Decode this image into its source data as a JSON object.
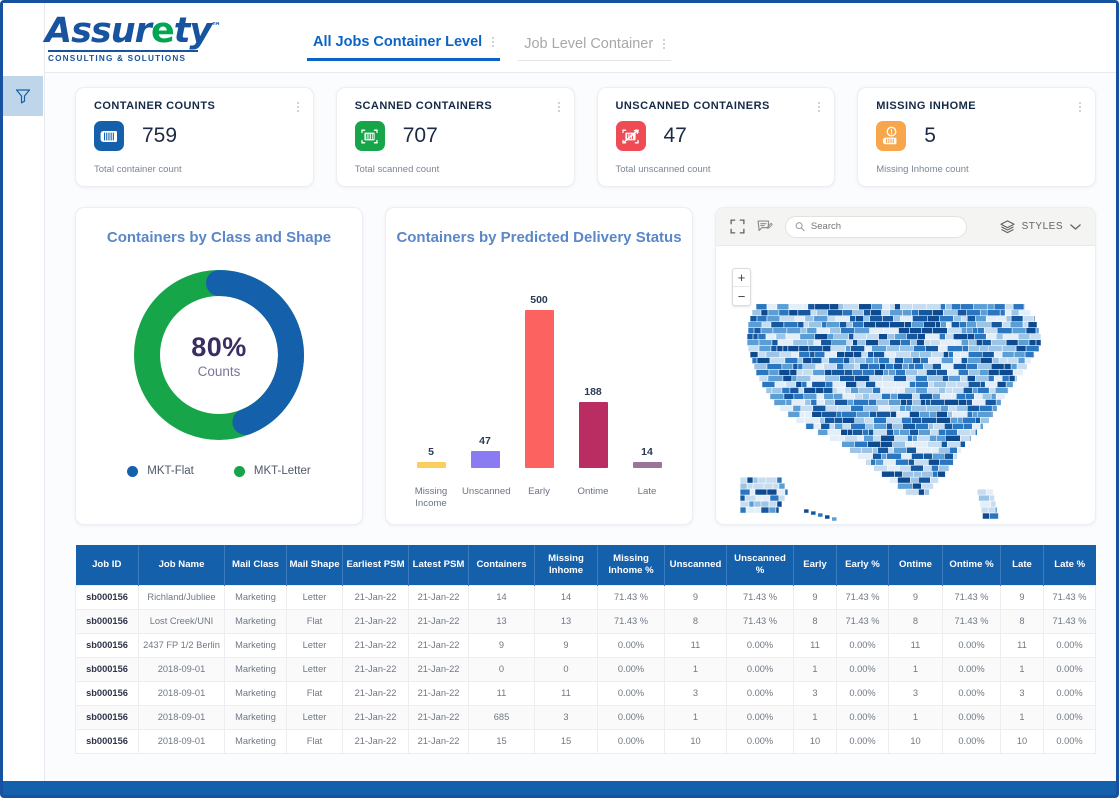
{
  "brand": {
    "wordmark_a": "Assur",
    "wordmark_e": "e",
    "wordmark_b": "ty",
    "tm": "™",
    "tagline": "CONSULTING & SOLUTIONS",
    "primary_blue": "#18539f",
    "accent_green": "#00a651"
  },
  "tabs": [
    {
      "label": "All Jobs Container Level",
      "active": true
    },
    {
      "label": "Job Level Container",
      "active": false
    }
  ],
  "kpis": [
    {
      "title": "CONTAINER COUNTS",
      "value": "759",
      "subtitle": "Total container count",
      "icon": "container-icon",
      "color": "#1560ab"
    },
    {
      "title": "SCANNED CONTAINERS",
      "value": "707",
      "subtitle": "Total scanned count",
      "icon": "scanned-container-icon",
      "color": "#17a54a"
    },
    {
      "title": "UNSCANNED CONTAINERS",
      "value": "47",
      "subtitle": "Total unscanned count",
      "icon": "unscanned-container-icon",
      "color": "#ef4b54"
    },
    {
      "title": "MISSING INHOME",
      "value": "5",
      "subtitle": "Missing Inhome count",
      "icon": "missing-inhome-icon",
      "color": "#f7a64b"
    }
  ],
  "chart_data": [
    {
      "type": "pie",
      "title": "Containers by Class and Shape",
      "center_value": "80%",
      "center_label": "Counts",
      "legend_position": "bottom",
      "categories": [
        "MKT-Flat",
        "MKT-Letter"
      ],
      "values": [
        44,
        56
      ],
      "colors": [
        "#1560ab",
        "#17a54a"
      ]
    },
    {
      "type": "bar",
      "title": "Containers by Predicted Delivery Status",
      "categories": [
        "Missing Income",
        "Unscanned",
        "Early",
        "Ontime",
        "Late"
      ],
      "values": [
        5,
        47,
        500,
        188,
        14
      ],
      "colors": [
        "#fbcf5f",
        "#8b7bf2",
        "#fb6260",
        "#b92d62",
        "#997598"
      ],
      "xlabel": "",
      "ylabel": "",
      "ylim": [
        0,
        500
      ],
      "grid": false
    }
  ],
  "map": {
    "search_placeholder": "Search",
    "styles_label": "STYLES",
    "zoom_in": "+",
    "zoom_out": "−"
  },
  "table": {
    "columns": [
      "Job ID",
      "Job Name",
      "Mail Class",
      "Mail Shape",
      "Earliest PSM",
      "Latest PSM",
      "Containers",
      "Missing Inhome",
      "Missing Inhome %",
      "Unscanned",
      "Unscanned %",
      "Early",
      "Early %",
      "Ontime",
      "Ontime %",
      "Late",
      "Late %"
    ],
    "rows": [
      [
        "sb000156",
        "Richland/Jubliee",
        "Marketing",
        "Letter",
        "21-Jan-22",
        "21-Jan-22",
        "14",
        "14",
        "71.43 %",
        "9",
        "71.43 %",
        "9",
        "71.43 %",
        "9",
        "71.43 %",
        "9",
        "71.43 %"
      ],
      [
        "sb000156",
        "Lost Creek/UNI",
        "Marketing",
        "Flat",
        "21-Jan-22",
        "21-Jan-22",
        "13",
        "13",
        "71.43 %",
        "8",
        "71.43 %",
        "8",
        "71.43 %",
        "8",
        "71.43 %",
        "8",
        "71.43 %"
      ],
      [
        "sb000156",
        "2437 FP 1/2 Berlin",
        "Marketing",
        "Letter",
        "21-Jan-22",
        "21-Jan-22",
        "9",
        "9",
        "0.00%",
        "11",
        "0.00%",
        "11",
        "0.00%",
        "11",
        "0.00%",
        "11",
        "0.00%"
      ],
      [
        "sb000156",
        "2018-09-01",
        "Marketing",
        "Letter",
        "21-Jan-22",
        "21-Jan-22",
        "0",
        "0",
        "0.00%",
        "1",
        "0.00%",
        "1",
        "0.00%",
        "1",
        "0.00%",
        "1",
        "0.00%"
      ],
      [
        "sb000156",
        "2018-09-01",
        "Marketing",
        "Flat",
        "21-Jan-22",
        "21-Jan-22",
        "11",
        "11",
        "0.00%",
        "3",
        "0.00%",
        "3",
        "0.00%",
        "3",
        "0.00%",
        "3",
        "0.00%"
      ],
      [
        "sb000156",
        "2018-09-01",
        "Marketing",
        "Letter",
        "21-Jan-22",
        "21-Jan-22",
        "685",
        "3",
        "0.00%",
        "1",
        "0.00%",
        "1",
        "0.00%",
        "1",
        "0.00%",
        "1",
        "0.00%"
      ],
      [
        "sb000156",
        "2018-09-01",
        "Marketing",
        "Flat",
        "21-Jan-22",
        "21-Jan-22",
        "15",
        "15",
        "0.00%",
        "10",
        "0.00%",
        "10",
        "0.00%",
        "10",
        "0.00%",
        "10",
        "0.00%"
      ]
    ]
  }
}
